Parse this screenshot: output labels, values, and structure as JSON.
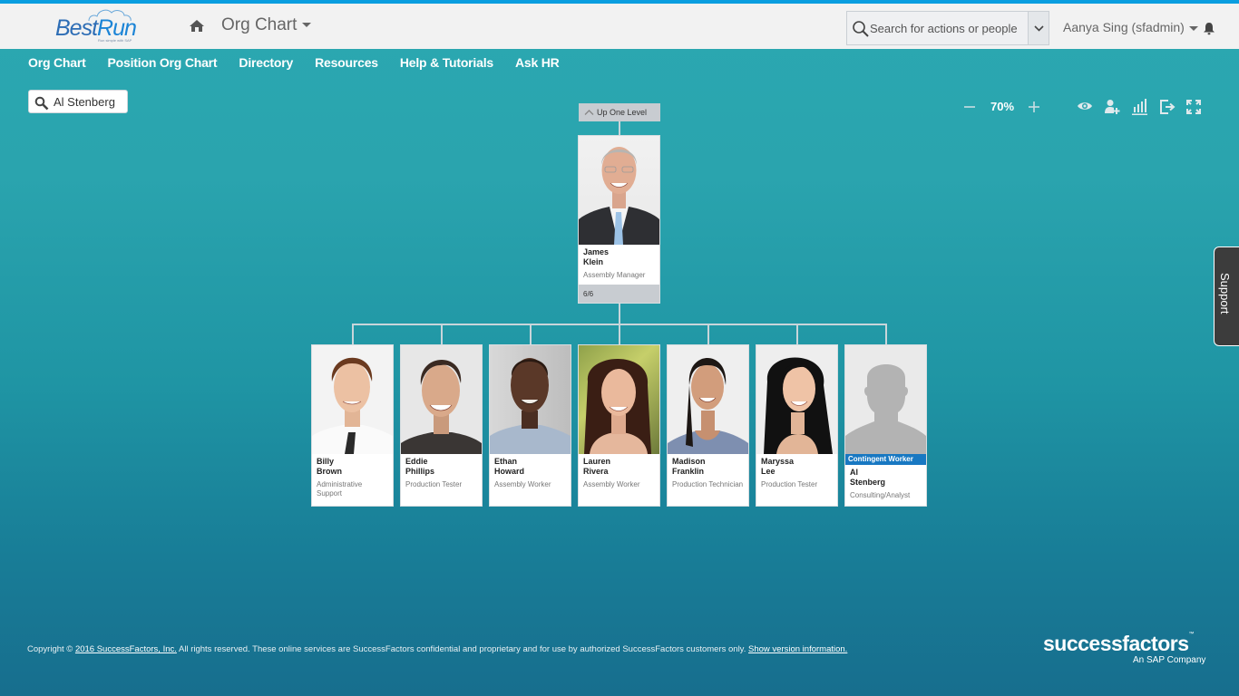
{
  "header": {
    "logo_brand": "BestRun",
    "logo_brand_part1": "Best",
    "logo_brand_part2": "Run",
    "logo_tagline": "Run simple with SAP",
    "app_title": "Org Chart",
    "search_placeholder": "Search for actions or people",
    "user_name": "Aanya Sing (sfadmin)",
    "accent_color": "#0a9ee0"
  },
  "nav": {
    "items": [
      {
        "label": "Org Chart"
      },
      {
        "label": "Position Org Chart"
      },
      {
        "label": "Directory"
      },
      {
        "label": "Resources"
      },
      {
        "label": "Help & Tutorials"
      },
      {
        "label": "Ask HR"
      }
    ]
  },
  "person_search": {
    "value": "Al Stenberg"
  },
  "toolbar": {
    "zoom_level": "70%",
    "icons": [
      "zoom-out-icon",
      "zoom-in-icon",
      "eye-icon",
      "add-person-icon",
      "bar-chart-icon",
      "export-icon",
      "fullscreen-icon"
    ]
  },
  "org_chart": {
    "up_one_level_label": "Up One Level",
    "manager": {
      "first_name": "James",
      "last_name": "Klein",
      "title": "Assembly Manager",
      "direct_reports": "6/6"
    },
    "reports": [
      {
        "first_name": "Billy",
        "last_name": "Brown",
        "title": "Administrative Support"
      },
      {
        "first_name": "Eddie",
        "last_name": "Phillips",
        "title": "Production Tester"
      },
      {
        "first_name": "Ethan",
        "last_name": "Howard",
        "title": "Assembly Worker"
      },
      {
        "first_name": "Lauren",
        "last_name": "Rivera",
        "title": "Assembly Worker"
      },
      {
        "first_name": "Madison",
        "last_name": "Franklin",
        "title": "Production Technician"
      },
      {
        "first_name": "Maryssa",
        "last_name": "Lee",
        "title": "Production Tester"
      },
      {
        "first_name": "Al",
        "last_name": "Stenberg",
        "title": "Consulting/Analyst",
        "badge": "Contingent Worker"
      }
    ]
  },
  "support_tab": {
    "label": "Support"
  },
  "footer": {
    "copyright_prefix": "Copyright © ",
    "copyright_link": "2016 SuccessFactors, Inc.",
    "copyright_text": " All rights reserved. These online services are SuccessFactors confidential and proprietary and for use by authorized SuccessFactors customers only. ",
    "version_link": "Show version information.",
    "brand": "successfactors",
    "brand_tm": "™",
    "brand_sub": "An SAP Company"
  }
}
